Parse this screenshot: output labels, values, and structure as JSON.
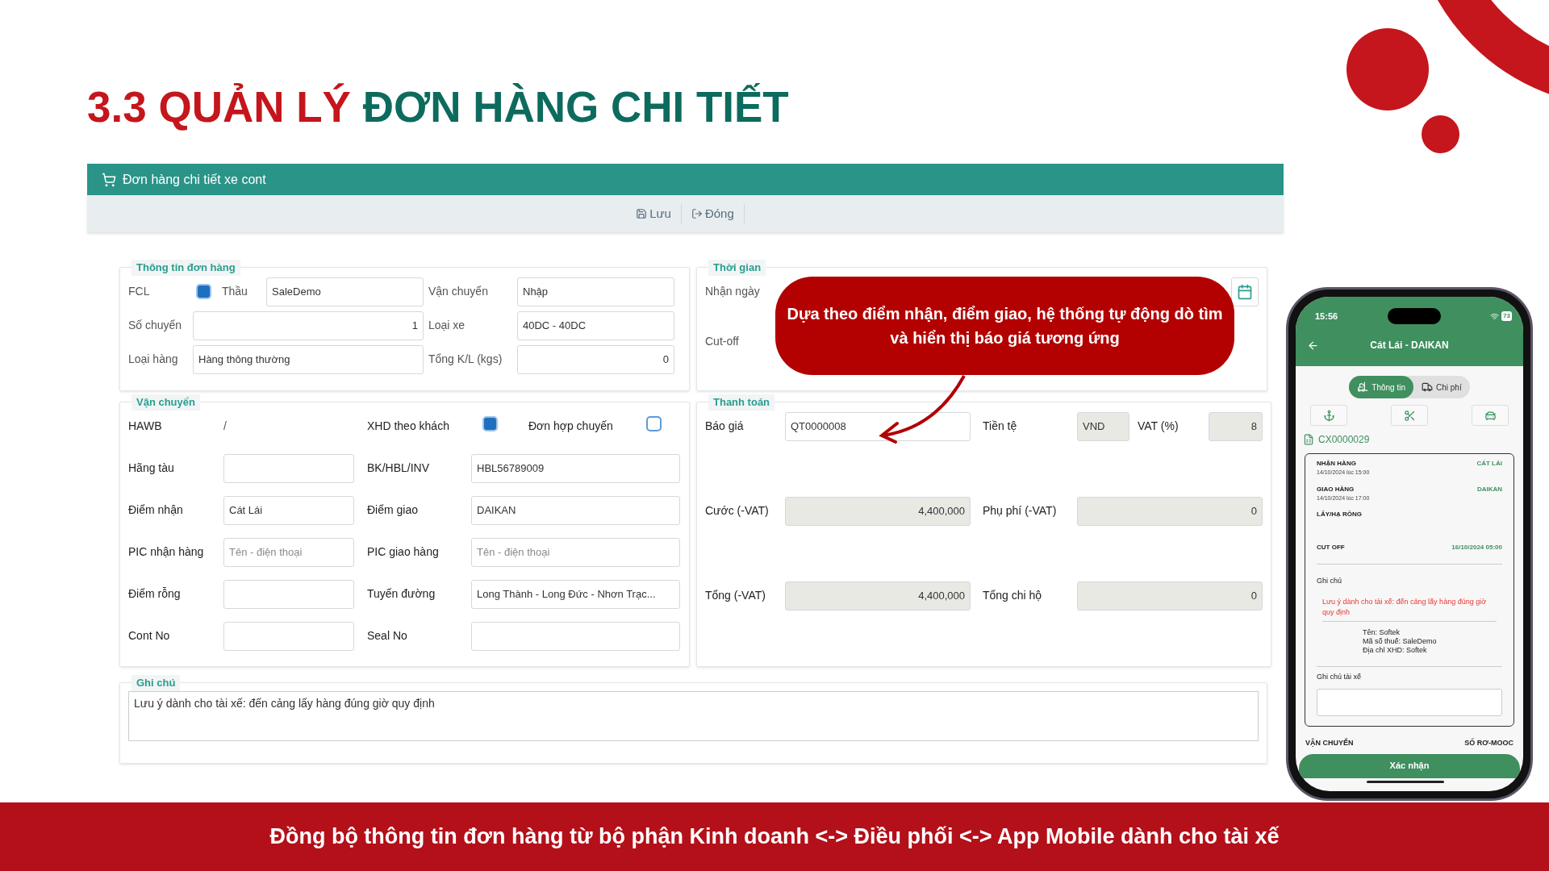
{
  "slide_title": {
    "lead": "3.3 QUẢN LÝ",
    "rest": "ĐƠN HÀNG CHI TIẾT"
  },
  "form": {
    "title": "Đơn hàng chi tiết xe cont",
    "toolbar": [
      {
        "label": "Lưu",
        "kind": "save"
      },
      {
        "label": "Đóng",
        "kind": "close"
      }
    ],
    "order_info": {
      "legend": "Thông tin đơn hàng",
      "fcl": {
        "label": "FCL",
        "checked": true
      },
      "fields": [
        {
          "label": "Thầu",
          "value": "SaleDemo",
          "kind": "text"
        },
        {
          "label": "Vận chuyển",
          "value": "Nhập",
          "kind": "text"
        },
        {
          "label": "Số chuyển",
          "value": "1",
          "kind": "number"
        },
        {
          "label": "Loại xe",
          "value": "40DC - 40DC",
          "kind": "text"
        },
        {
          "label": "Loại hàng",
          "value": "Hàng thông thường",
          "kind": "text"
        },
        {
          "label": "Tổng K/L (kgs)",
          "value": "0",
          "kind": "number"
        }
      ]
    },
    "time": {
      "legend": "Thời gian",
      "fields": [
        {
          "label": "Nhận ngày",
          "kind": "date"
        },
        {
          "label": "Cut-off",
          "kind": "hidden"
        }
      ]
    },
    "transport": {
      "legend": "Vận chuyển",
      "hawb": {
        "label": "HAWB",
        "value": "/"
      },
      "checks": [
        {
          "label": "XHD theo khách",
          "checked": true
        },
        {
          "label": "Đơn hợp chuyến",
          "checked": false
        }
      ],
      "fields": [
        {
          "label": "Hãng tàu"
        },
        {
          "label": "BK/HBL/INV",
          "value": "HBL56789009"
        },
        {
          "label": "Điểm nhận",
          "value": "Cát Lái"
        },
        {
          "label": "Điểm giao",
          "value": "DAIKAN"
        },
        {
          "label": "PIC nhận hàng",
          "placeholder": "Tên - điện thoại"
        },
        {
          "label": "PIC giao hàng",
          "placeholder": "Tên - điện thoại"
        },
        {
          "label": "Điểm rỗng"
        },
        {
          "label": "Tuyến đường",
          "value": "Long Thành - Long Đức - Nhơn Trạc..."
        },
        {
          "label": "Cont No"
        },
        {
          "label": "Seal No"
        }
      ]
    },
    "payment": {
      "legend": "Thanh toán",
      "rows": [
        {
          "fields": [
            {
              "label": "Báo giá",
              "value": "QT0000008",
              "kind": "text",
              "disabled": false
            },
            {
              "label": "Tiền tệ",
              "value": "VND",
              "kind": "text",
              "disabled": true
            },
            {
              "label": "VAT (%)",
              "value": "8",
              "kind": "number",
              "disabled": true
            }
          ]
        },
        {
          "fields": [
            {
              "label": "Cước (-VAT)",
              "value": "4,400,000",
              "kind": "number",
              "disabled": true
            },
            {
              "label": "Phụ phí (-VAT)",
              "value": "0",
              "kind": "number",
              "disabled": true
            }
          ]
        },
        {
          "fields": [
            {
              "label": "Tổng (-VAT)",
              "value": "4,400,000",
              "kind": "number",
              "disabled": true
            },
            {
              "label": "Tổng chi hộ",
              "value": "0",
              "kind": "number",
              "disabled": true
            }
          ]
        }
      ]
    },
    "note": {
      "legend": "Ghi chú",
      "value": "Lưu ý dành cho tài xế: đến cảng lấy hàng đúng giờ quy định"
    }
  },
  "callout": "Dựa theo điểm nhận, điểm giao, hệ thống tự động dò tìm và hiển thị báo giá tương ứng",
  "phone": {
    "time": "15:56",
    "battery": "73",
    "title": "Cát Lái - DAIKAN",
    "tabs": [
      {
        "label": "Thông tin",
        "kind": "info",
        "selected": true
      },
      {
        "label": "Chi phí",
        "kind": "truck",
        "selected": false
      }
    ],
    "actions": [
      {
        "kind": "anchor"
      },
      {
        "kind": "scissors"
      },
      {
        "kind": "car"
      }
    ],
    "order_code": "CX0000029",
    "stops": [
      {
        "label": "NHẬN HÀNG",
        "time": "14/10/2024 lúc 15:00",
        "place": "CÁT LÁI"
      },
      {
        "label": "GIAO HÀNG",
        "time": "14/10/2024 lúc 17:00",
        "place": "DAIKAN"
      },
      {
        "label": "LẤY/HẠ RỖNG"
      }
    ],
    "cutoff": {
      "label": "CUT OFF",
      "value": "16/10/2024 05:00"
    },
    "note_label": "Ghi chú",
    "note": "Lưu ý dành cho tài xế: đến cảng lấy hàng đúng giờ quy định",
    "invoice_lines": [
      "Tên: Softek",
      "Mã số thuế: SaleDemo",
      "Địa chỉ XHD: Softek"
    ],
    "driver_note_label": "Ghi chú tài xế",
    "bottom_labels": [
      "VẬN CHUYỂN",
      "SỐ RƠ-MOOC"
    ],
    "confirm": "Xác nhận"
  },
  "footer": "Đồng bộ thông tin đơn hàng từ bộ phận Kinh doanh <-> Điều phối <-> App Mobile dành cho tài xế"
}
